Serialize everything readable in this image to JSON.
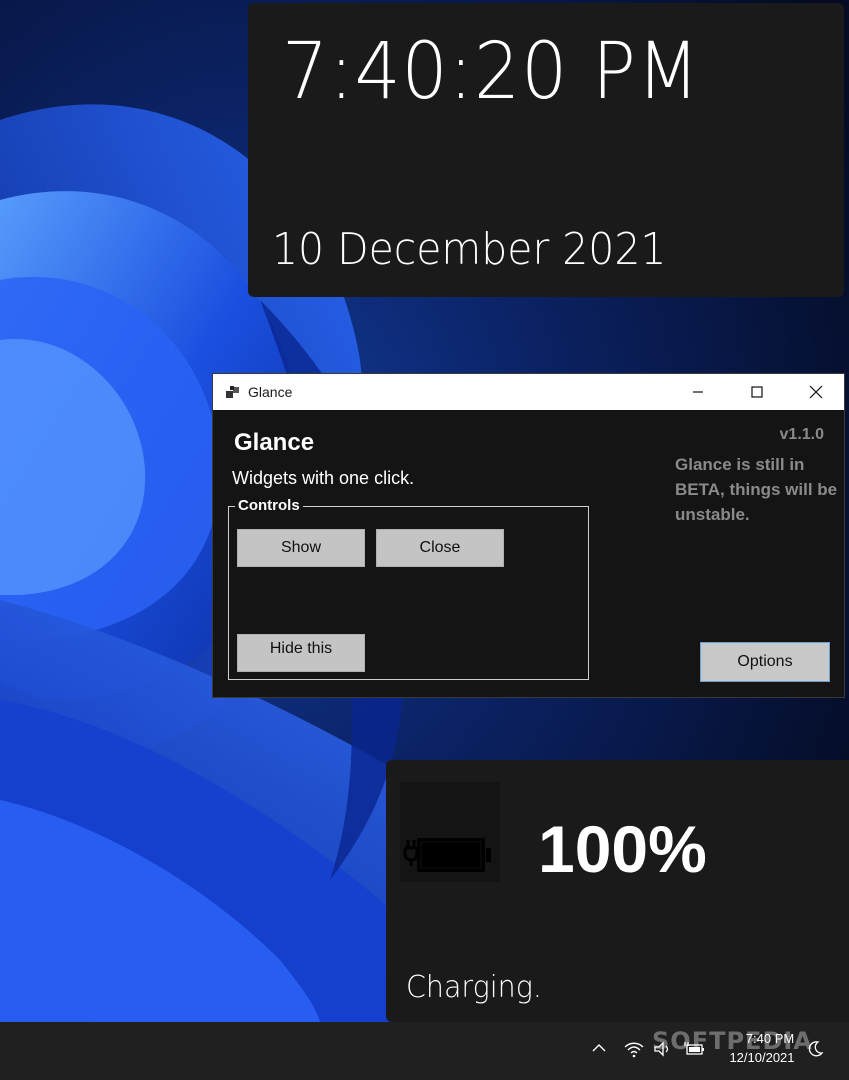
{
  "clock_widget": {
    "time": "7:40:20 PM",
    "date": "10 December 2021"
  },
  "window": {
    "title": "Glance",
    "heading": "Glance",
    "subtitle": "Widgets with one click.",
    "version": "v1.1.0",
    "beta_note_lines": [
      "Glance is still in",
      "BETA, things will be",
      "unstable."
    ],
    "controls": {
      "legend": "Controls",
      "show_label": "Show",
      "close_label": "Close",
      "hide_label": "Hide this"
    },
    "options_label": "Options",
    "titlebar_icons": {
      "app": "glance-app-icon",
      "minimize": "minimize-icon",
      "maximize": "maximize-icon",
      "close": "close-icon"
    }
  },
  "battery_widget": {
    "percent": "100%",
    "status": "Charging.",
    "icon": "battery-charging-icon"
  },
  "taskbar": {
    "time": "7:40 PM",
    "date": "12/10/2021",
    "watermark": "SOFTPEDIA",
    "tray_icons": [
      "chevron-up-icon",
      "wifi-icon",
      "volume-icon",
      "battery-icon",
      "notification-moon-icon"
    ]
  },
  "colors": {
    "widget_bg": "#1a1a1a",
    "window_bg": "#141414",
    "button_bg": "#c4c4c4",
    "accent_border": "#6aa0d6",
    "muted_text": "#8a8a8a"
  }
}
